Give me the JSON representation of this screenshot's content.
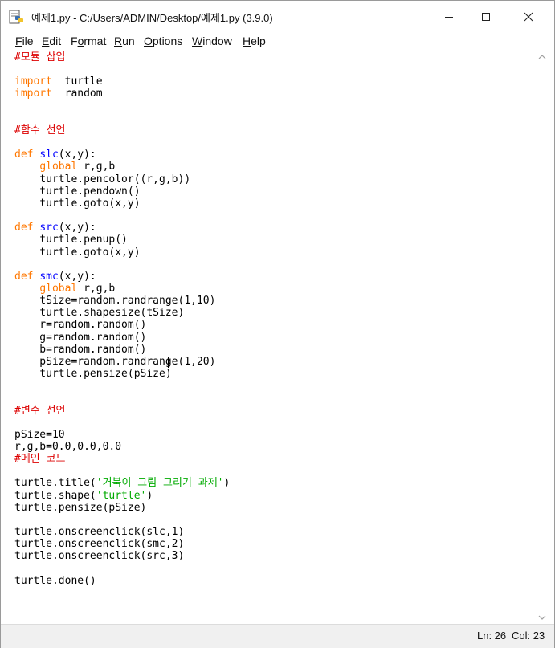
{
  "window": {
    "title": "예제1.py - C:/Users/ADMIN/Desktop/예제1.py (3.9.0)"
  },
  "menu": [
    {
      "label": "File",
      "mnemonic": "F",
      "rest": "ile"
    },
    {
      "label": "Edit",
      "mnemonic": "E",
      "rest": "dit"
    },
    {
      "label": "Format",
      "mnemonic": "o",
      "before": "F",
      "rest": "rmat"
    },
    {
      "label": "Run",
      "mnemonic": "R",
      "rest": "un"
    },
    {
      "label": "Options",
      "mnemonic": "O",
      "rest": "ptions"
    },
    {
      "label": "Window",
      "mnemonic": "W",
      "rest": "indow"
    },
    {
      "label": "Help",
      "mnemonic": "H",
      "rest": "elp"
    }
  ],
  "editor": {
    "lines": [
      [
        [
          "cm",
          "#모듈 삽입"
        ]
      ],
      [],
      [
        [
          "kw",
          "import"
        ],
        [
          "",
          "  turtle"
        ]
      ],
      [
        [
          "kw",
          "import"
        ],
        [
          "",
          "  random"
        ]
      ],
      [],
      [],
      [
        [
          "cm",
          "#함수 선언"
        ]
      ],
      [],
      [
        [
          "kw",
          "def"
        ],
        [
          "",
          " "
        ],
        [
          "def",
          "slc"
        ],
        [
          "",
          "(x,y):"
        ]
      ],
      [
        [
          "",
          "    "
        ],
        [
          "kw",
          "global"
        ],
        [
          "",
          " r,g,b"
        ]
      ],
      [
        [
          "",
          "    turtle.pencolor((r,g,b))"
        ]
      ],
      [
        [
          "",
          "    turtle.pendown()"
        ]
      ],
      [
        [
          "",
          "    turtle.goto(x,y)"
        ]
      ],
      [],
      [
        [
          "kw",
          "def"
        ],
        [
          "",
          " "
        ],
        [
          "def",
          "src"
        ],
        [
          "",
          "(x,y):"
        ]
      ],
      [
        [
          "",
          "    turtle.penup()"
        ]
      ],
      [
        [
          "",
          "    turtle.goto(x,y)"
        ]
      ],
      [],
      [
        [
          "kw",
          "def"
        ],
        [
          "",
          " "
        ],
        [
          "def",
          "smc"
        ],
        [
          "",
          "(x,y):"
        ]
      ],
      [
        [
          "",
          "    "
        ],
        [
          "kw",
          "global"
        ],
        [
          "",
          " r,g,b"
        ]
      ],
      [
        [
          "",
          "    tSize=random.randrange(1,10)"
        ]
      ],
      [
        [
          "",
          "    turtle.shapesize(tSize)"
        ]
      ],
      [
        [
          "",
          "    r=random.random()"
        ]
      ],
      [
        [
          "",
          "    g=random.random()"
        ]
      ],
      [
        [
          "",
          "    b=random.random()"
        ]
      ],
      [
        [
          "",
          "    pSize=random.randrange(1,20)"
        ]
      ],
      [
        [
          "",
          "    turtle.pensize(pSize)"
        ]
      ],
      [],
      [],
      [
        [
          "cm",
          "#변수 선언"
        ]
      ],
      [],
      [
        [
          "",
          "pSize=10"
        ]
      ],
      [
        [
          "",
          "r,g,b=0.0,0.0,0.0"
        ]
      ],
      [
        [
          "cm",
          "#메인 코드"
        ]
      ],
      [],
      [
        [
          "",
          "turtle.title("
        ],
        [
          "str",
          "'거북이 그림 그리기 과제'"
        ],
        [
          "",
          ")"
        ]
      ],
      [
        [
          "",
          "turtle.shape("
        ],
        [
          "str",
          "'turtle'"
        ],
        [
          "",
          ")"
        ]
      ],
      [
        [
          "",
          "turtle.pensize(pSize)"
        ]
      ],
      [],
      [
        [
          "",
          "turtle.onscreenclick(slc,1)"
        ]
      ],
      [
        [
          "",
          "turtle.onscreenclick(smc,2)"
        ]
      ],
      [
        [
          "",
          "turtle.onscreenclick(src,3)"
        ]
      ],
      [],
      [
        [
          "",
          "turtle.done()"
        ]
      ]
    ]
  },
  "status": {
    "line": "Ln: 26",
    "col": "Col: 23"
  },
  "icons": {
    "app": "idle-python-file-icon",
    "minimize": "minimize-icon",
    "maximize": "maximize-icon",
    "close": "close-icon",
    "scroll_up": "chevron-up-icon",
    "scroll_down": "chevron-down-icon"
  },
  "colors": {
    "keyword": "#ff7700",
    "definition": "#0000ff",
    "comment": "#dd0000",
    "string": "#00aa00"
  }
}
